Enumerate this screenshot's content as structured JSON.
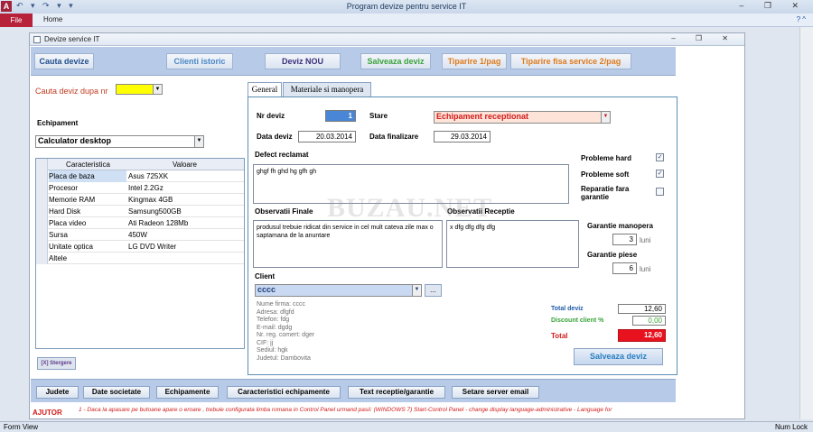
{
  "titlebar": {
    "app_letter": "A",
    "qat": "↶ ▾ ↷ ▾ ▾",
    "title": "Program devize pentru service IT",
    "controls": "– ❐ ✕"
  },
  "ribbon": {
    "file": "File",
    "home": "Home",
    "help": "? ^"
  },
  "doc": {
    "title": "Devize service IT",
    "controls": "– ❐ ✕"
  },
  "toolbar": {
    "cauta": "Cauta devize",
    "clienti": "Clienti istoric",
    "nou": "Deviz NOU",
    "salveaza": "Salveaza deviz",
    "tiparire1": "Tiparire 1/pag",
    "tiparire2": "Tiparire fisa service 2/pag"
  },
  "left": {
    "search_label": "Cauta deviz dupa nr",
    "search_value": "",
    "echipament_label": "Echipament",
    "echipament_value": "Calculator desktop",
    "grid_headers": [
      "Caracteristica",
      "Valoare"
    ],
    "rows": [
      {
        "k": "Placa de baza",
        "v": "Asus 725XK"
      },
      {
        "k": "Procesor",
        "v": "Intel 2.2Gz"
      },
      {
        "k": "Memorie RAM",
        "v": "Kingmax 4GB"
      },
      {
        "k": "Hard Disk",
        "v": "Samsung500GB"
      },
      {
        "k": "Placa video",
        "v": "Ati Radeon 128Mb"
      },
      {
        "k": "Sursa",
        "v": "450W"
      },
      {
        "k": "Unitate optica",
        "v": "LG DVD Writer"
      },
      {
        "k": "Altele",
        "v": ""
      }
    ],
    "stergere": "[X] Stergere"
  },
  "tabs": [
    "General",
    "Materiale si manopera"
  ],
  "form": {
    "nr_label": "Nr deviz",
    "nr_value": "1",
    "stare_label": "Stare",
    "stare_value": "Echipament receptionat",
    "data_label": "Data deviz",
    "data_value": "20.03.2014",
    "finalizare_label": "Data finalizare",
    "finalizare_value": "29.03.2014",
    "defect_label": "Defect reclamat",
    "defect_value": "ghgf fh ghd hg gfh gh",
    "probleme_hard": "Probleme hard",
    "probleme_soft": "Probleme soft",
    "reparatie1": "Reparatie fara",
    "reparatie2": "garantie",
    "obs_finale_label": "Observatii Finale",
    "obs_finale_value": "produsul trebuie ridicat din service in cel mult cateva zile max o saptamana de la anuntare",
    "obs_receptie_label": "Observatii Receptie",
    "obs_receptie_value": "x dfg dfg dfg dfg",
    "gar_manopera_label": "Garantie manopera",
    "gar_manopera_value": "3",
    "luni": "luni",
    "gar_piese_label": "Garantie piese",
    "gar_piese_value": "6",
    "client_label": "Client",
    "client_value": "cccc",
    "client_more": "...",
    "client_details": [
      "Nume firma: cccc",
      "Adresa: dfgfd",
      "Telefon: fdg",
      "E-mail: dgdg",
      "Nr. reg. comert: dger",
      "CIF: jj",
      "Sediul: hgk",
      "Judetul: Dambovita"
    ],
    "total_deviz_label": "Total deviz",
    "total_deviz_value": "12,60",
    "discount_label": "Discount client %",
    "discount_value": "0,00",
    "total_label": "Total",
    "total_value": "12,60",
    "save_button": "Salveaza deviz"
  },
  "bottom": {
    "buttons": [
      "Judete",
      "Date societate",
      "Echipamente",
      "Caracteristici echipamente",
      "Text receptie/garantie",
      "Setare server email"
    ],
    "ajutor": "AJUTOR",
    "help_text": "1 - Daca la apasare pe butoane apare o eroare , trebuie configurata limba romana in Control Panel urmand pasii: (WINDOWS 7) Start-Control Panel - change display language-administrative - Language for"
  },
  "watermark": "BUZAU.NET",
  "status": {
    "left": "Form View",
    "right": "Num Lock"
  },
  "colors": {
    "accent": "#b7213a",
    "toolbar": "#b7cbe8",
    "total_red": "#e8121e",
    "search_yellow": "#ffff00"
  }
}
